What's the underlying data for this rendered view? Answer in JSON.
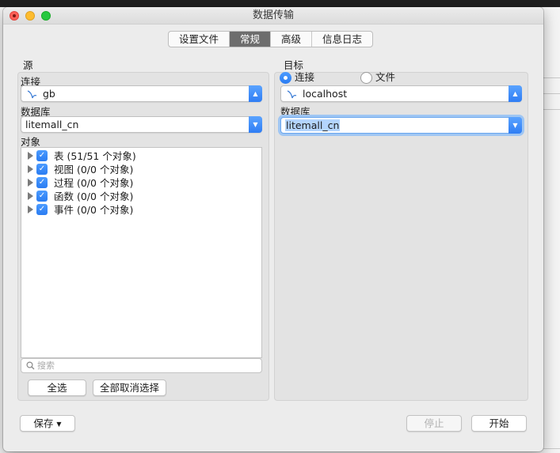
{
  "window": {
    "title": "数据传输"
  },
  "tabs": [
    {
      "label": "设置文件",
      "active": false
    },
    {
      "label": "常规",
      "active": true
    },
    {
      "label": "高级",
      "active": false
    },
    {
      "label": "信息日志",
      "active": false
    }
  ],
  "source": {
    "title": "源",
    "connection_label": "连接",
    "connection_value": "gb",
    "database_label": "数据库",
    "database_value": "litemall_cn",
    "objects_label": "对象",
    "objects": [
      {
        "label": "表 (51/51 个对象)",
        "checked": true
      },
      {
        "label": "视图 (0/0 个对象)",
        "checked": true
      },
      {
        "label": "过程 (0/0 个对象)",
        "checked": true
      },
      {
        "label": "函数 (0/0 个对象)",
        "checked": true
      },
      {
        "label": "事件 (0/0 个对象)",
        "checked": true
      }
    ],
    "search_placeholder": "搜索",
    "select_all_label": "全选",
    "deselect_all_label": "全部取消选择"
  },
  "target": {
    "title": "目标",
    "radio_connection_label": "连接",
    "radio_file_label": "文件",
    "selected_mode": "连接",
    "connection_value": "localhost",
    "database_label": "数据库",
    "database_value": "litemall_cn"
  },
  "footer": {
    "save_label": "保存",
    "stop_label": "停止",
    "start_label": "开始"
  },
  "colors": {
    "accent": "#2f7df4",
    "active_tab": "#6d6d6d",
    "close": "#fe5f57",
    "minimize": "#febc2e",
    "maximize": "#28c840"
  }
}
